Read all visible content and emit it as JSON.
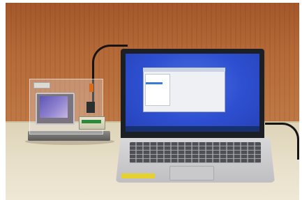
{
  "scene": {
    "description_colors": {
      "wall": "#b4683a",
      "table": "#e8dfc9",
      "laptop_screen": "#2d4fd0",
      "display_screen": "#7a6fc4",
      "laptop_body": "#cfcfd2"
    }
  }
}
